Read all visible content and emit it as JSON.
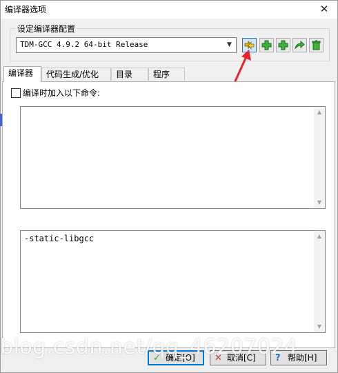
{
  "window": {
    "title": "编译器选项",
    "close_glyph": "✕"
  },
  "compiler_set": {
    "legend": "设定编译器配置",
    "selected": "TDM-GCC 4.9.2 64-bit Release",
    "toolbar_icons": [
      "find-compiler-icon",
      "add-green-icon",
      "add-green-icon",
      "rename-arrow-icon",
      "delete-trash-icon"
    ]
  },
  "tabs": [
    {
      "label": "编译器",
      "selected": true
    },
    {
      "label": "代码生成/优化",
      "selected": false
    },
    {
      "label": "目录",
      "selected": false
    },
    {
      "label": "程序",
      "selected": false
    }
  ],
  "compiler_tab": {
    "checkbox_label": "编译时加入以下命令:",
    "checked": false,
    "compiler_commands": "",
    "linker_commands": "-static-libgcc"
  },
  "buttons": {
    "ok": "确定[O]",
    "cancel": "取消[C]",
    "help": "帮助[H]"
  },
  "watermark": "blog.csdn.net/qq_46207024",
  "colors": {
    "accent": "#0078d7",
    "arrow": "#e8262a",
    "icon_green": "#2e9e2e"
  }
}
